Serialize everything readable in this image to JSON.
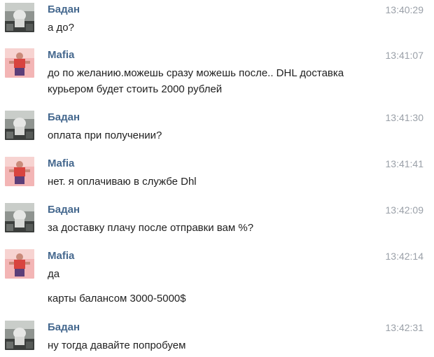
{
  "messages": [
    {
      "author": "Бадан",
      "time": "13:40:29",
      "avatar": "badan-avatar",
      "lines": [
        "а до?"
      ]
    },
    {
      "author": "Mafia",
      "time": "13:41:07",
      "avatar": "mafia-avatar",
      "lines": [
        "до по желанию.можешь сразу можешь после.. DHL доставка",
        "курьером будет стоить 2000 рублей"
      ]
    },
    {
      "author": "Бадан",
      "time": "13:41:30",
      "avatar": "badan-avatar",
      "lines": [
        "оплата при получении?"
      ]
    },
    {
      "author": "Mafia",
      "time": "13:41:41",
      "avatar": "mafia-avatar",
      "lines": [
        "нет. я оплачиваю в службе Dhl"
      ]
    },
    {
      "author": "Бадан",
      "time": "13:42:09",
      "avatar": "badan-avatar",
      "lines": [
        "за доставку плачу после отправки вам %?"
      ]
    },
    {
      "author": "Mafia",
      "time": "13:42:14",
      "avatar": "mafia-avatar",
      "lines": [
        "да",
        "карты балансом 3000-5000$"
      ]
    },
    {
      "author": "Бадан",
      "time": "13:42:31",
      "avatar": "badan-avatar",
      "lines": [
        "ну тогда давайте попробуем"
      ]
    }
  ],
  "colors": {
    "author": "#45688e",
    "time": "#9aa0a8",
    "text": "#1f1f1f"
  }
}
